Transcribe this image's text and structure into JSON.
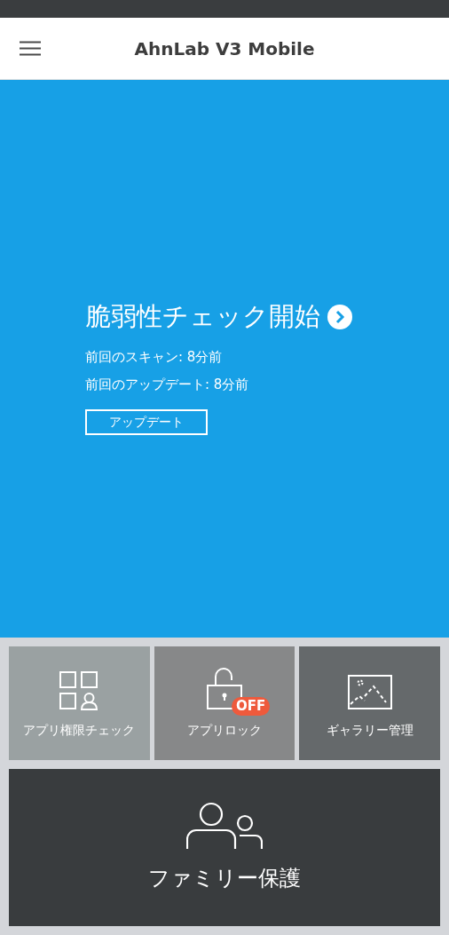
{
  "app_bar": {
    "title": "AhnLab V3 Mobile"
  },
  "hero": {
    "title": "脆弱性チェック開始",
    "last_scan": "前回のスキャン: 8分前",
    "last_update": "前回のアップデート: 8分前",
    "update_button": "アップデート"
  },
  "tiles": [
    {
      "kind": "permissions",
      "label": "アプリ権限チェック"
    },
    {
      "kind": "lock",
      "label": "アプリロック",
      "badge": "OFF"
    },
    {
      "kind": "gallery",
      "label": "ギャラリー管理"
    }
  ],
  "family_tile": {
    "label": "ファミリー保護"
  }
}
